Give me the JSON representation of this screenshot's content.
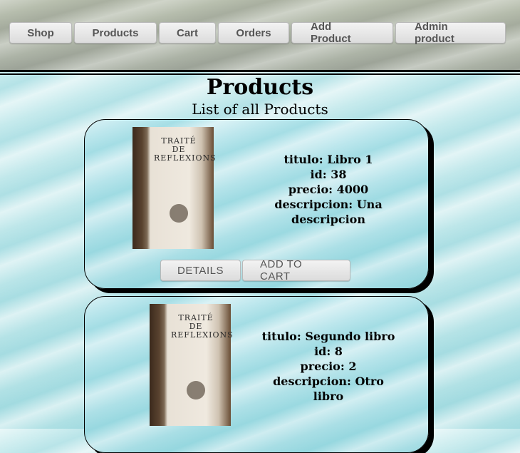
{
  "nav": {
    "items": [
      "Shop",
      "Products",
      "Cart",
      "Orders",
      "Add Product",
      "Admin product"
    ]
  },
  "page": {
    "title": "Products",
    "subtitle": "List of all Products"
  },
  "products": [
    {
      "titulo": "titulo: Libro 1",
      "id": "id: 38",
      "precio": "precio: 4000",
      "descripcion_1": "descripcion: Una",
      "descripcion_2": "descripcion",
      "image_icon": "book-cover-image"
    },
    {
      "titulo": "titulo: Segundo libro",
      "id": "id: 8",
      "precio": "precio: 2",
      "descripcion_1": "descripcion: Otro",
      "descripcion_2": "libro",
      "image_icon": "book-cover-image"
    }
  ],
  "actions": {
    "details_label": "DETAILS",
    "add_to_cart_label": "ADD TO CART"
  },
  "colors": {
    "nav_bar": "#aab1a5",
    "background": "#b9e6ea",
    "button_text": "#555555"
  }
}
